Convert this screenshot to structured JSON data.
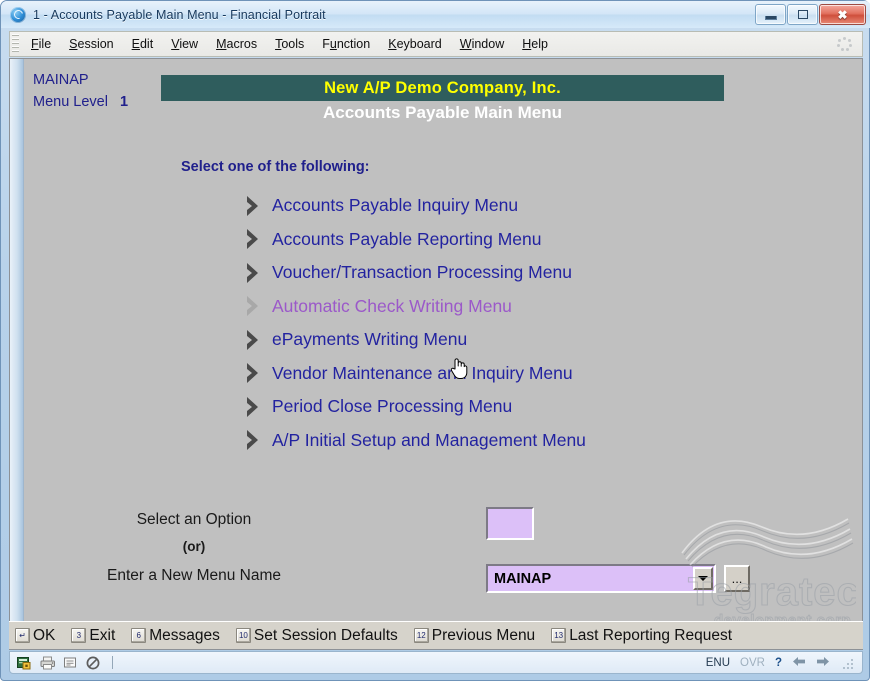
{
  "window": {
    "title": "1 - Accounts Payable Main Menu - Financial Portrait",
    "icon": "globe-icon",
    "minimize_label": "Minimize",
    "maximize_label": "Maximize",
    "close_label": "Close"
  },
  "menubar": {
    "items": [
      {
        "label": "File",
        "accel": "F"
      },
      {
        "label": "Session",
        "accel": "S"
      },
      {
        "label": "Edit",
        "accel": "E"
      },
      {
        "label": "View",
        "accel": "V"
      },
      {
        "label": "Macros",
        "accel": "M"
      },
      {
        "label": "Tools",
        "accel": "T"
      },
      {
        "label": "Function",
        "accel": "u"
      },
      {
        "label": "Keyboard",
        "accel": "K"
      },
      {
        "label": "Window",
        "accel": "W"
      },
      {
        "label": "Help",
        "accel": "H"
      }
    ]
  },
  "screen": {
    "menu_id": "MAINAP",
    "menu_level_label": "Menu Level",
    "menu_level_value": "1",
    "company_banner": "New A/P Demo Company, Inc.",
    "page_subtitle": "Accounts Payable Main Menu",
    "select_prompt": "Select one of the following:",
    "options": [
      {
        "label": "Accounts Payable Inquiry Menu",
        "highlighted": false
      },
      {
        "label": "Accounts Payable Reporting Menu",
        "highlighted": false
      },
      {
        "label": "Voucher/Transaction Processing Menu",
        "highlighted": false
      },
      {
        "label": "Automatic Check Writing Menu",
        "highlighted": true
      },
      {
        "label": "ePayments Writing Menu",
        "highlighted": false
      },
      {
        "label": "Vendor Maintenance and Inquiry Menu",
        "highlighted": false
      },
      {
        "label": "Period Close Processing Menu",
        "highlighted": false
      },
      {
        "label": "A/P Initial Setup and Management Menu",
        "highlighted": false
      }
    ],
    "form": {
      "option_label": "Select an Option",
      "or_label": "(or)",
      "new_menu_label": "Enter a New Menu Name",
      "option_value": "",
      "new_menu_value": "MAINAP",
      "browse_label": "...",
      "dropdown_icon": "chevron-down-icon"
    },
    "watermark": {
      "name": "Tegratecs",
      "tagline": "development corp."
    },
    "colors": {
      "banner_bg": "#2F5D5D",
      "banner_text": "#FFFF00",
      "subtitle_text": "#FFFFFF",
      "option_text": "#2323A0",
      "option_highlight_text": "#9B59C9",
      "screen_bg": "#C0C0C0",
      "input_bg": "#DCC0F8"
    }
  },
  "function_keys": [
    {
      "key": "↵",
      "label": "OK"
    },
    {
      "key": "3",
      "label": "Exit"
    },
    {
      "key": "6",
      "label": "Messages"
    },
    {
      "key": "10",
      "label": "Set Session Defaults"
    },
    {
      "key": "12",
      "label": "Previous Menu"
    },
    {
      "key": "13",
      "label": "Last Reporting Request"
    }
  ],
  "statusbar": {
    "icons": [
      "secure-session-icon",
      "printer-icon",
      "document-icon",
      "blocked-icon"
    ],
    "language": "ENU",
    "overwrite_mode": "OVR",
    "help": "?",
    "back_icon": "arrow-left-icon",
    "forward_icon": "arrow-right-icon",
    "resize_grip": "resize-grip-icon"
  }
}
